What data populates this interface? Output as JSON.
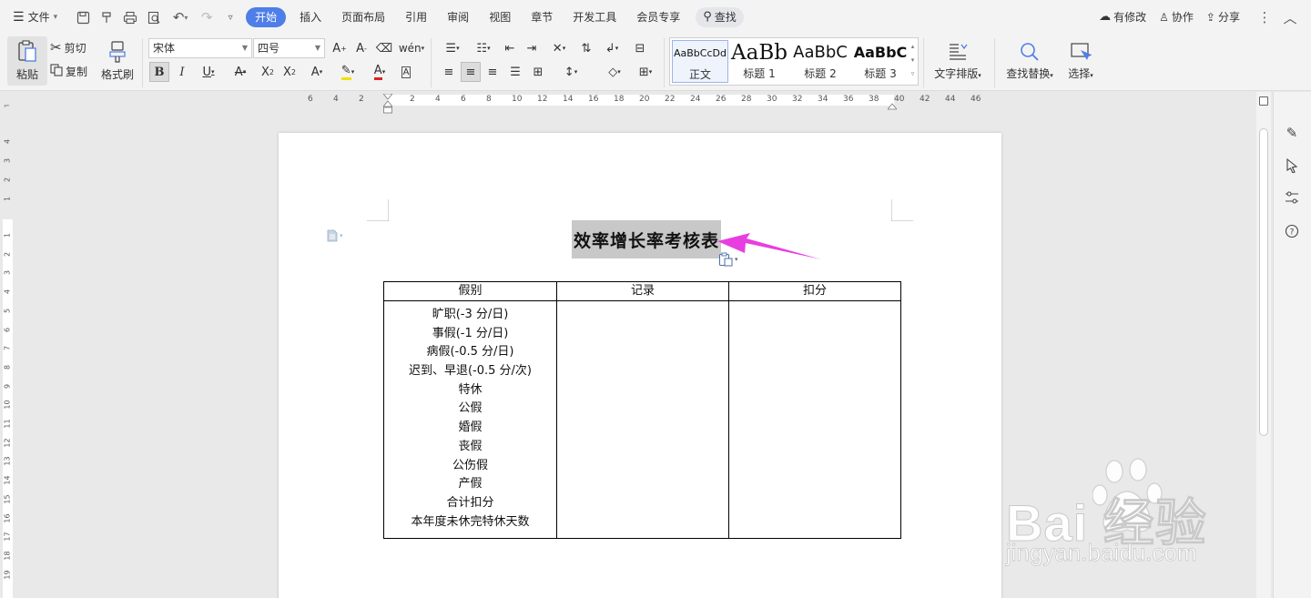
{
  "menubar": {
    "file_label": "文件",
    "tabs": [
      "开始",
      "插入",
      "页面布局",
      "引用",
      "审阅",
      "视图",
      "章节",
      "开发工具",
      "会员专享"
    ],
    "search_label": "查找",
    "status_label": "有修改",
    "collab_label": "协作",
    "share_label": "分享"
  },
  "ribbon": {
    "paste_label": "粘贴",
    "cut_label": "剪切",
    "copy_label": "复制",
    "format_painter_label": "格式刷",
    "font_name": "宋体",
    "font_size": "四号",
    "styles": [
      {
        "preview": "AaBbCcDd",
        "name": "正文"
      },
      {
        "preview": "AaBb",
        "name": "标题 1"
      },
      {
        "preview": "AaBbC",
        "name": "标题 2"
      },
      {
        "preview": "AaBbC",
        "name": "标题 3"
      }
    ],
    "text_layout_label": "文字排版",
    "find_replace_label": "查找替换",
    "select_label": "选择"
  },
  "ruler": {
    "h_ticks": [
      "6",
      "4",
      "2",
      "2",
      "4",
      "6",
      "8",
      "10",
      "12",
      "14",
      "16",
      "18",
      "20",
      "22",
      "24",
      "26",
      "28",
      "30",
      "32",
      "34",
      "36",
      "38",
      "40",
      "42",
      "44",
      "46"
    ],
    "v_ticks_top": [
      "4",
      "3",
      "2",
      "1"
    ],
    "v_ticks": [
      "1",
      "2",
      "3",
      "4",
      "5",
      "6",
      "7",
      "8",
      "9",
      "10",
      "11",
      "12",
      "13",
      "14",
      "15",
      "16",
      "17",
      "18",
      "19"
    ]
  },
  "document": {
    "title": "效率增长率考核表",
    "table_headers": [
      "假别",
      "记录",
      "扣分"
    ],
    "leave_items": [
      "旷职(-3 分/日)",
      "事假(-1 分/日)",
      "病假(-0.5 分/日)",
      "迟到、早退(-0.5 分/次)",
      "特休",
      "公假",
      "婚假",
      "丧假",
      "公伤假",
      "产假",
      "合计扣分",
      "本年度未休完特休天数"
    ],
    "record_cell": "",
    "deduction_cell": ""
  },
  "watermark": {
    "brand": "Bai 经验",
    "url": "jingyan.baidu.com"
  },
  "colors": {
    "accent": "#4e7ee8",
    "annotation_arrow": "#e83ee0",
    "title_highlight": "#c8c8c8"
  }
}
